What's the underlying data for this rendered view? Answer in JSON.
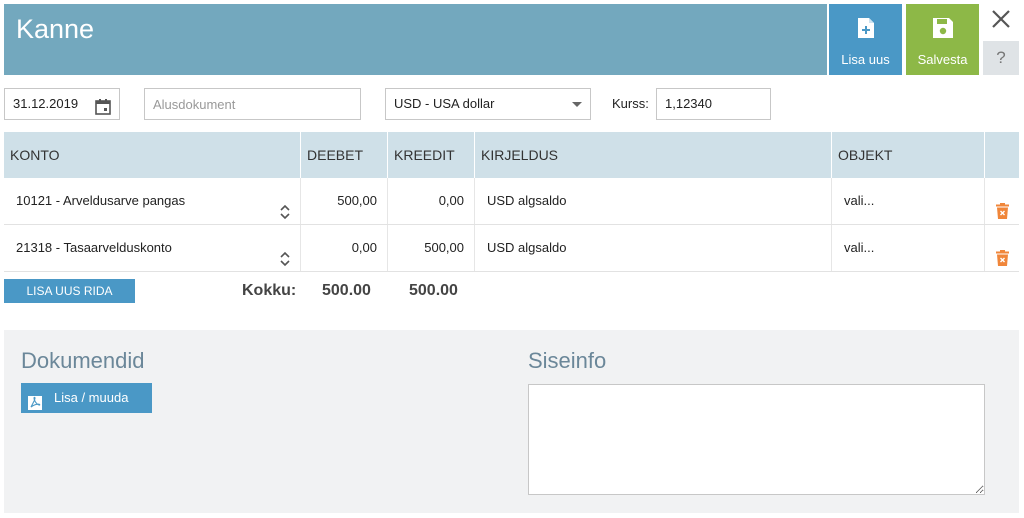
{
  "header": {
    "title": "Kanne",
    "new_label": "Lisa uus",
    "save_label": "Salvesta",
    "help_label": "?"
  },
  "form": {
    "date": "31.12.2019",
    "doc_placeholder": "Alusdokument",
    "currency": "USD - USA dollar",
    "rate_label": "Kurss:",
    "rate": "1,12340"
  },
  "table": {
    "headers": {
      "konto": "KONTO",
      "deebet": "DEEBET",
      "kreedit": "KREEDIT",
      "kirjeldus": "KIRJELDUS",
      "objekt": "OBJEKT"
    },
    "rows": [
      {
        "konto": "10121 - Arveldusarve pangas",
        "deebet": "500,00",
        "kreedit": "0,00",
        "kirjeldus": "USD algsaldo",
        "objekt": "vali..."
      },
      {
        "konto": "21318 - Tasaarvelduskonto",
        "deebet": "0,00",
        "kreedit": "500,00",
        "kirjeldus": "USD algsaldo",
        "objekt": "vali..."
      }
    ],
    "add_row_label": "LISA UUS RIDA",
    "total_label": "Kokku:",
    "total_deebet": "500.00",
    "total_kreedit": "500.00"
  },
  "bottom": {
    "docs_title": "Dokumendid",
    "docs_button": "Lisa / muuda",
    "info_title": "Siseinfo"
  },
  "colors": {
    "header_bg": "#73a8be",
    "primary_blue": "#4a98c6",
    "save_green": "#8db847",
    "delete_orange": "#f0863a",
    "table_header_bg": "#cfe0e8"
  },
  "icons": {
    "new": "file-plus-icon",
    "save": "floppy-disk-icon",
    "close": "close-icon",
    "calendar": "calendar-icon",
    "dropdown": "caret-down-icon",
    "sort": "chevron-up-down-icon",
    "delete": "trash-icon",
    "pdf": "pdf-icon"
  }
}
